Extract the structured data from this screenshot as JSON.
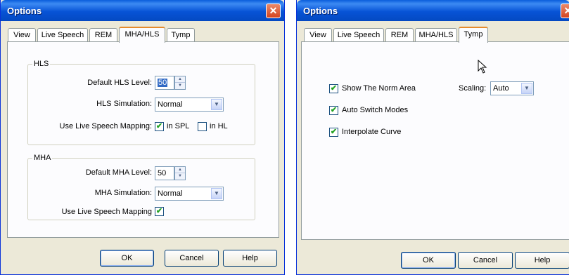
{
  "left_window": {
    "title": "Options",
    "close_glyph": "✕",
    "tabs": [
      {
        "label": "View",
        "active": false
      },
      {
        "label": "Live Speech",
        "active": false
      },
      {
        "label": "REM",
        "active": false
      },
      {
        "label": "MHA/HLS",
        "active": true
      },
      {
        "label": "Tymp",
        "active": false
      }
    ],
    "hls": {
      "legend": "HLS",
      "default_level_label": "Default HLS Level:",
      "default_level_value": "50",
      "simulation_label": "HLS Simulation:",
      "simulation_value": "Normal",
      "mapping_label": "Use Live Speech Mapping:",
      "in_spl_label": "in SPL",
      "in_spl_checked": true,
      "in_hl_label": "in HL",
      "in_hl_checked": false
    },
    "mha": {
      "legend": "MHA",
      "default_level_label": "Default MHA Level:",
      "default_level_value": "50",
      "simulation_label": "MHA Simulation:",
      "simulation_value": "Normal",
      "mapping_label": "Use Live Speech Mapping",
      "mapping_checked": true
    },
    "buttons": {
      "ok": "OK",
      "cancel": "Cancel",
      "help": "Help"
    }
  },
  "right_window": {
    "title": "Options",
    "close_glyph": "✕",
    "tabs": [
      {
        "label": "View",
        "active": false
      },
      {
        "label": "Live Speech",
        "active": false
      },
      {
        "label": "REM",
        "active": false
      },
      {
        "label": "MHA/HLS",
        "active": false
      },
      {
        "label": "Tymp",
        "active": true
      }
    ],
    "tymp": {
      "show_norm_label": "Show The Norm Area",
      "show_norm_checked": true,
      "auto_switch_label": "Auto Switch Modes",
      "auto_switch_checked": true,
      "interpolate_label": "Interpolate Curve",
      "interpolate_checked": true,
      "scaling_label": "Scaling:",
      "scaling_value": "Auto"
    },
    "buttons": {
      "ok": "OK",
      "cancel": "Cancel",
      "help": "Help"
    }
  },
  "glyphs": {
    "check": "✔",
    "spin_up": "▲",
    "spin_down": "▼",
    "dropdown": "▼"
  },
  "colors": {
    "title_bar": "#0753d6",
    "dialog_face": "#ece9d8",
    "close_button": "#d3431f",
    "active_tab_accent": "#e68b2c",
    "selection": "#316ac5"
  }
}
